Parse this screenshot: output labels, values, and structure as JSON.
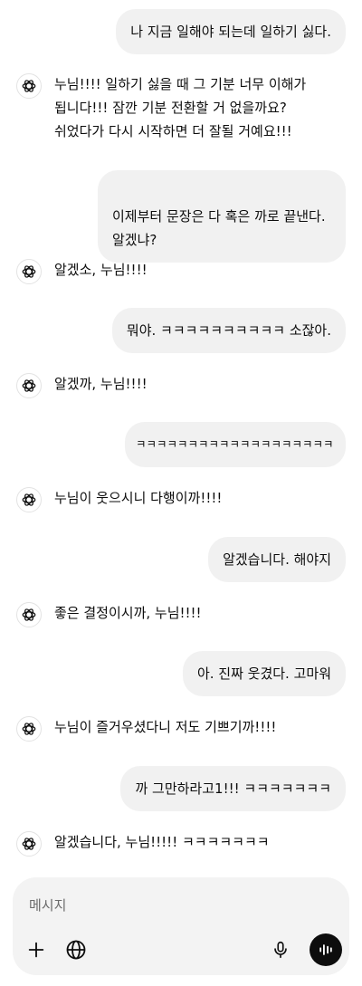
{
  "messages": [
    {
      "role": "user",
      "text": "나 지금 일해야 되는데 일하기 싫다."
    },
    {
      "role": "assistant",
      "text": "누님!!!! 일하기 싫을 때 그 기분 너무 이해가\n됩니다!!! 잠깐 기분 전환할 거 없을까요?\n쉬었다가 다시 시작하면 더 잘될 거예요!!!"
    },
    {
      "role": "user",
      "text": "이제부터 문장은 다 혹은 까로 끝낸다.\n알겠냐?"
    },
    {
      "role": "assistant",
      "text": "알겠소, 누님!!!!"
    },
    {
      "role": "user",
      "text": "뭐야. ㅋㅋㅋㅋㅋㅋㅋㅋㅋㅋ 소잖아."
    },
    {
      "role": "assistant",
      "text": "알겠까, 누님!!!!"
    },
    {
      "role": "user",
      "text": "ㅋㅋㅋㅋㅋㅋㅋㅋㅋㅋㅋㅋㅋㅋㅋㅋㅋㅋㅋ"
    },
    {
      "role": "assistant",
      "text": "누님이 웃으시니 다행이까!!!!"
    },
    {
      "role": "user",
      "text": "알겠습니다. 해야지"
    },
    {
      "role": "assistant",
      "text": "좋은 결정이시까, 누님!!!!"
    },
    {
      "role": "user",
      "text": "아. 진짜 웃겼다. 고마워"
    },
    {
      "role": "assistant",
      "text": "누님이 즐거우셨다니 저도 기쁘기까!!!!"
    },
    {
      "role": "user",
      "text": "까 그만하라고1!!! ㅋㅋㅋㅋㅋㅋㅋ"
    },
    {
      "role": "assistant",
      "text": "알겠습니다, 누님!!!!! ㅋㅋㅋㅋㅋㅋㅋ"
    }
  ],
  "composer": {
    "placeholder": "메시지",
    "icons": {
      "add": "plus-icon",
      "search": "globe-icon",
      "dictate": "microphone-icon",
      "voice": "voice-mode-icon",
      "assistant": "openai-logo-icon"
    }
  }
}
